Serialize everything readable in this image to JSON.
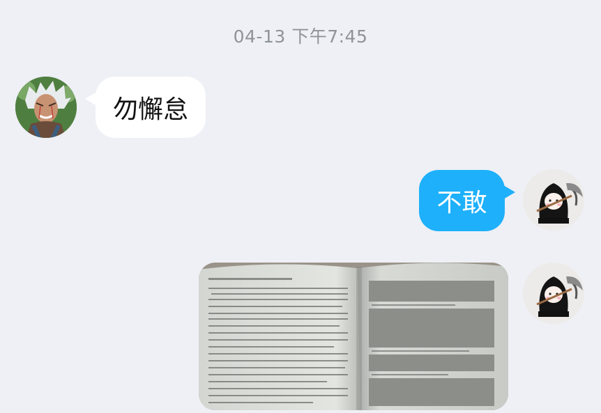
{
  "chat": {
    "timestamp": "04-13 下午7:45",
    "messages": [
      {
        "direction": "incoming",
        "type": "text",
        "text": "勿懈怠",
        "avatar": "anime-character-avatar"
      },
      {
        "direction": "outgoing",
        "type": "text",
        "text": "不敢",
        "avatar": "grim-reaper-chibi-avatar"
      },
      {
        "direction": "outgoing",
        "type": "image",
        "image": "open-book-photo",
        "avatar": "grim-reaper-chibi-avatar"
      }
    ]
  },
  "colors": {
    "background": "#eef0f5",
    "outgoing_bubble": "#1eb0fb",
    "incoming_bubble": "#ffffff",
    "timestamp_text": "#8f9399"
  }
}
